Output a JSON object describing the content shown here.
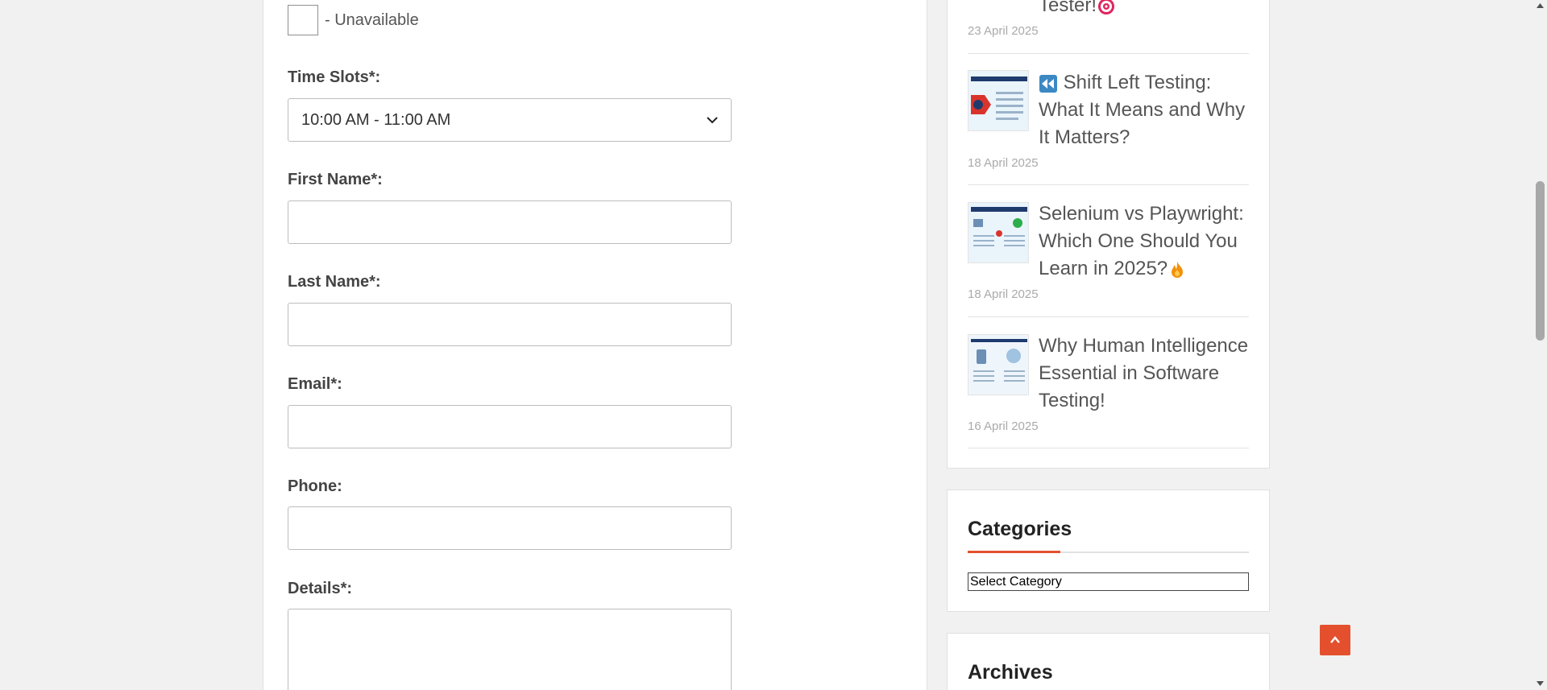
{
  "form": {
    "legend_unavailable": "- Unavailable",
    "time_slots_label": "Time Slots*:",
    "time_slot_selected": "10:00 AM - 11:00 AM",
    "first_name_label": "First Name*:",
    "last_name_label": "Last Name*:",
    "email_label": "Email*:",
    "phone_label": "Phone:",
    "details_label": "Details*:"
  },
  "sidebar": {
    "posts": [
      {
        "title": "Tester!",
        "date": "23 April 2025"
      },
      {
        "title": "Shift Left Testing: What It Means and Why It Matters?",
        "date": "18 April 2025"
      },
      {
        "title": "Selenium vs Playwright: Which One Should You Learn in 2025?",
        "date": "18 April 2025"
      },
      {
        "title": "Why Human Intelligence Essential in Software Testing!",
        "date": "16 April 2025"
      }
    ],
    "categories_title": "Categories",
    "category_select": "Select Category",
    "archives_title": "Archives"
  },
  "colors": {
    "accent": "#e4502d",
    "background": "#f1f1f1"
  }
}
